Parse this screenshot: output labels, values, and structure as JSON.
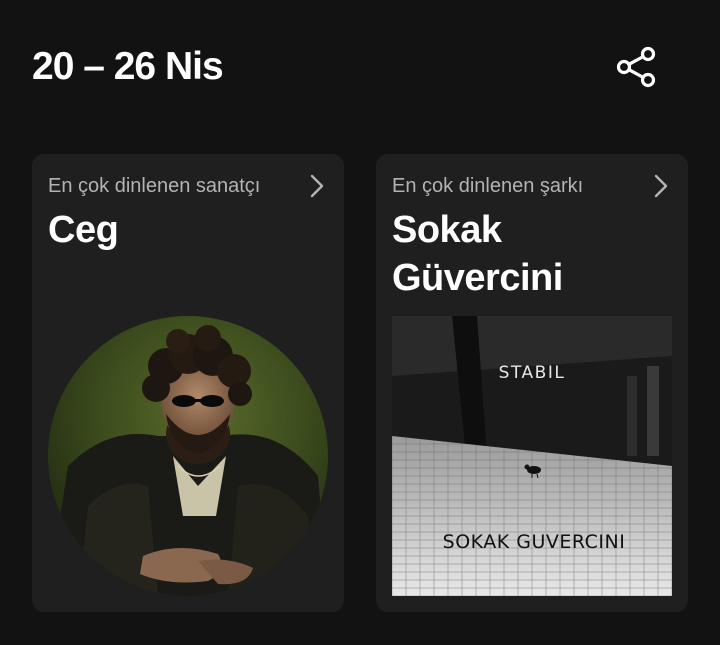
{
  "header": {
    "week_range": "20 – 26 Nis",
    "share_icon": "share-icon"
  },
  "cards": {
    "top_artist": {
      "label": "En çok dinlenen sanatçı",
      "name": "Ceg",
      "chevron_icon": "chevron-right-icon"
    },
    "top_song": {
      "label": "En çok dinlenen şarkı",
      "title": "Sokak Güvercini",
      "chevron_icon": "chevron-right-icon",
      "cover_artist_text": "STABIL",
      "cover_title_text": "SOKAK GUVERCINI"
    }
  },
  "colors": {
    "background": "#121212",
    "card": "#1f1f1f",
    "label_gray": "#b3b3b3",
    "text_white": "#ffffff"
  }
}
